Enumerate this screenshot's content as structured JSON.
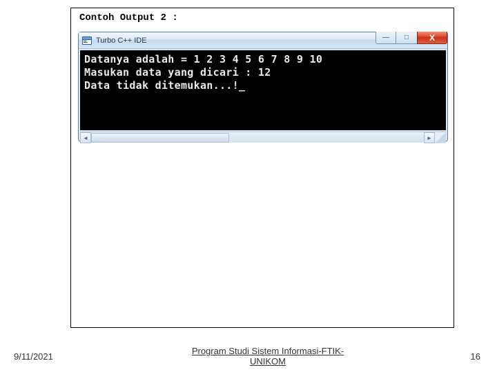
{
  "heading": "Contoh Output 2 :",
  "window": {
    "title": "Turbo C++ IDE",
    "console_lines": [
      "Datanya adalah = 1 2 3 4 5 6 7 8 9 10",
      "Masukan data yang dicari : 12",
      "Data tidak ditemukan...!"
    ],
    "cursor": "_",
    "controls": {
      "minimize": "—",
      "maximize": "□",
      "close": "X"
    },
    "scrollbar": {
      "left_arrow": "◄",
      "right_arrow": "►"
    }
  },
  "footer": {
    "date": "9/11/2021",
    "center_line1": "Program Studi Sistem Informasi-FTIK-",
    "center_line2": "UNIKOM",
    "page": "16"
  }
}
